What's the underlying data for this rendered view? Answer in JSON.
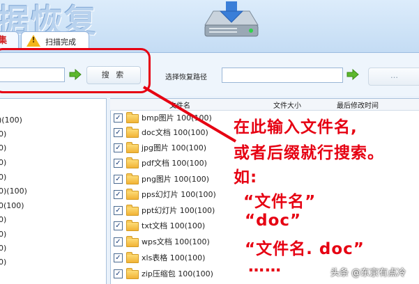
{
  "header": {
    "logo_text": "据恢复",
    "tab_left_label": "集",
    "tab_scan_label": "扫描完成",
    "warning_glyph": "!"
  },
  "toolbar": {
    "search_button_label": "搜 索",
    "path_label": "选择恢复路径",
    "browse_button_label": "…"
  },
  "left_panel": {
    "items": [
      ")(100)",
      "0)",
      "0)",
      "0)",
      "0)",
      "0)(100)",
      "0(100)",
      "0)",
      "0)",
      "0)",
      "0)"
    ]
  },
  "right_panel": {
    "columns": [
      "文件名",
      "文件大小",
      "最后修改时间"
    ],
    "rows": [
      {
        "checked": "✓",
        "label": "bmp图片 100(100)"
      },
      {
        "checked": "✓",
        "label": "doc文档 100(100)"
      },
      {
        "checked": "✓",
        "label": "jpg图片 100(100)"
      },
      {
        "checked": "✓",
        "label": "pdf文档 100(100)"
      },
      {
        "checked": "✓",
        "label": "png图片 100(100)"
      },
      {
        "checked": "✓",
        "label": "pps幻灯片 100(100)"
      },
      {
        "checked": "✓",
        "label": "ppt幻灯片 100(100)"
      },
      {
        "checked": "✓",
        "label": "txt文档 100(100)"
      },
      {
        "checked": "✓",
        "label": "wps文档 100(100)"
      },
      {
        "checked": "✓",
        "label": "xls表格 100(100)"
      },
      {
        "checked": "✓",
        "label": "zip压缩包 100(100)"
      }
    ]
  },
  "annotation": {
    "lines": [
      "在此输入文件名,",
      "或者后缀就行搜索。",
      "如:",
      "“文件名”",
      "“doc”",
      "“文件名. doc”",
      "……"
    ],
    "color": "#e60012"
  },
  "watermark": "头条 @东京有点冷"
}
